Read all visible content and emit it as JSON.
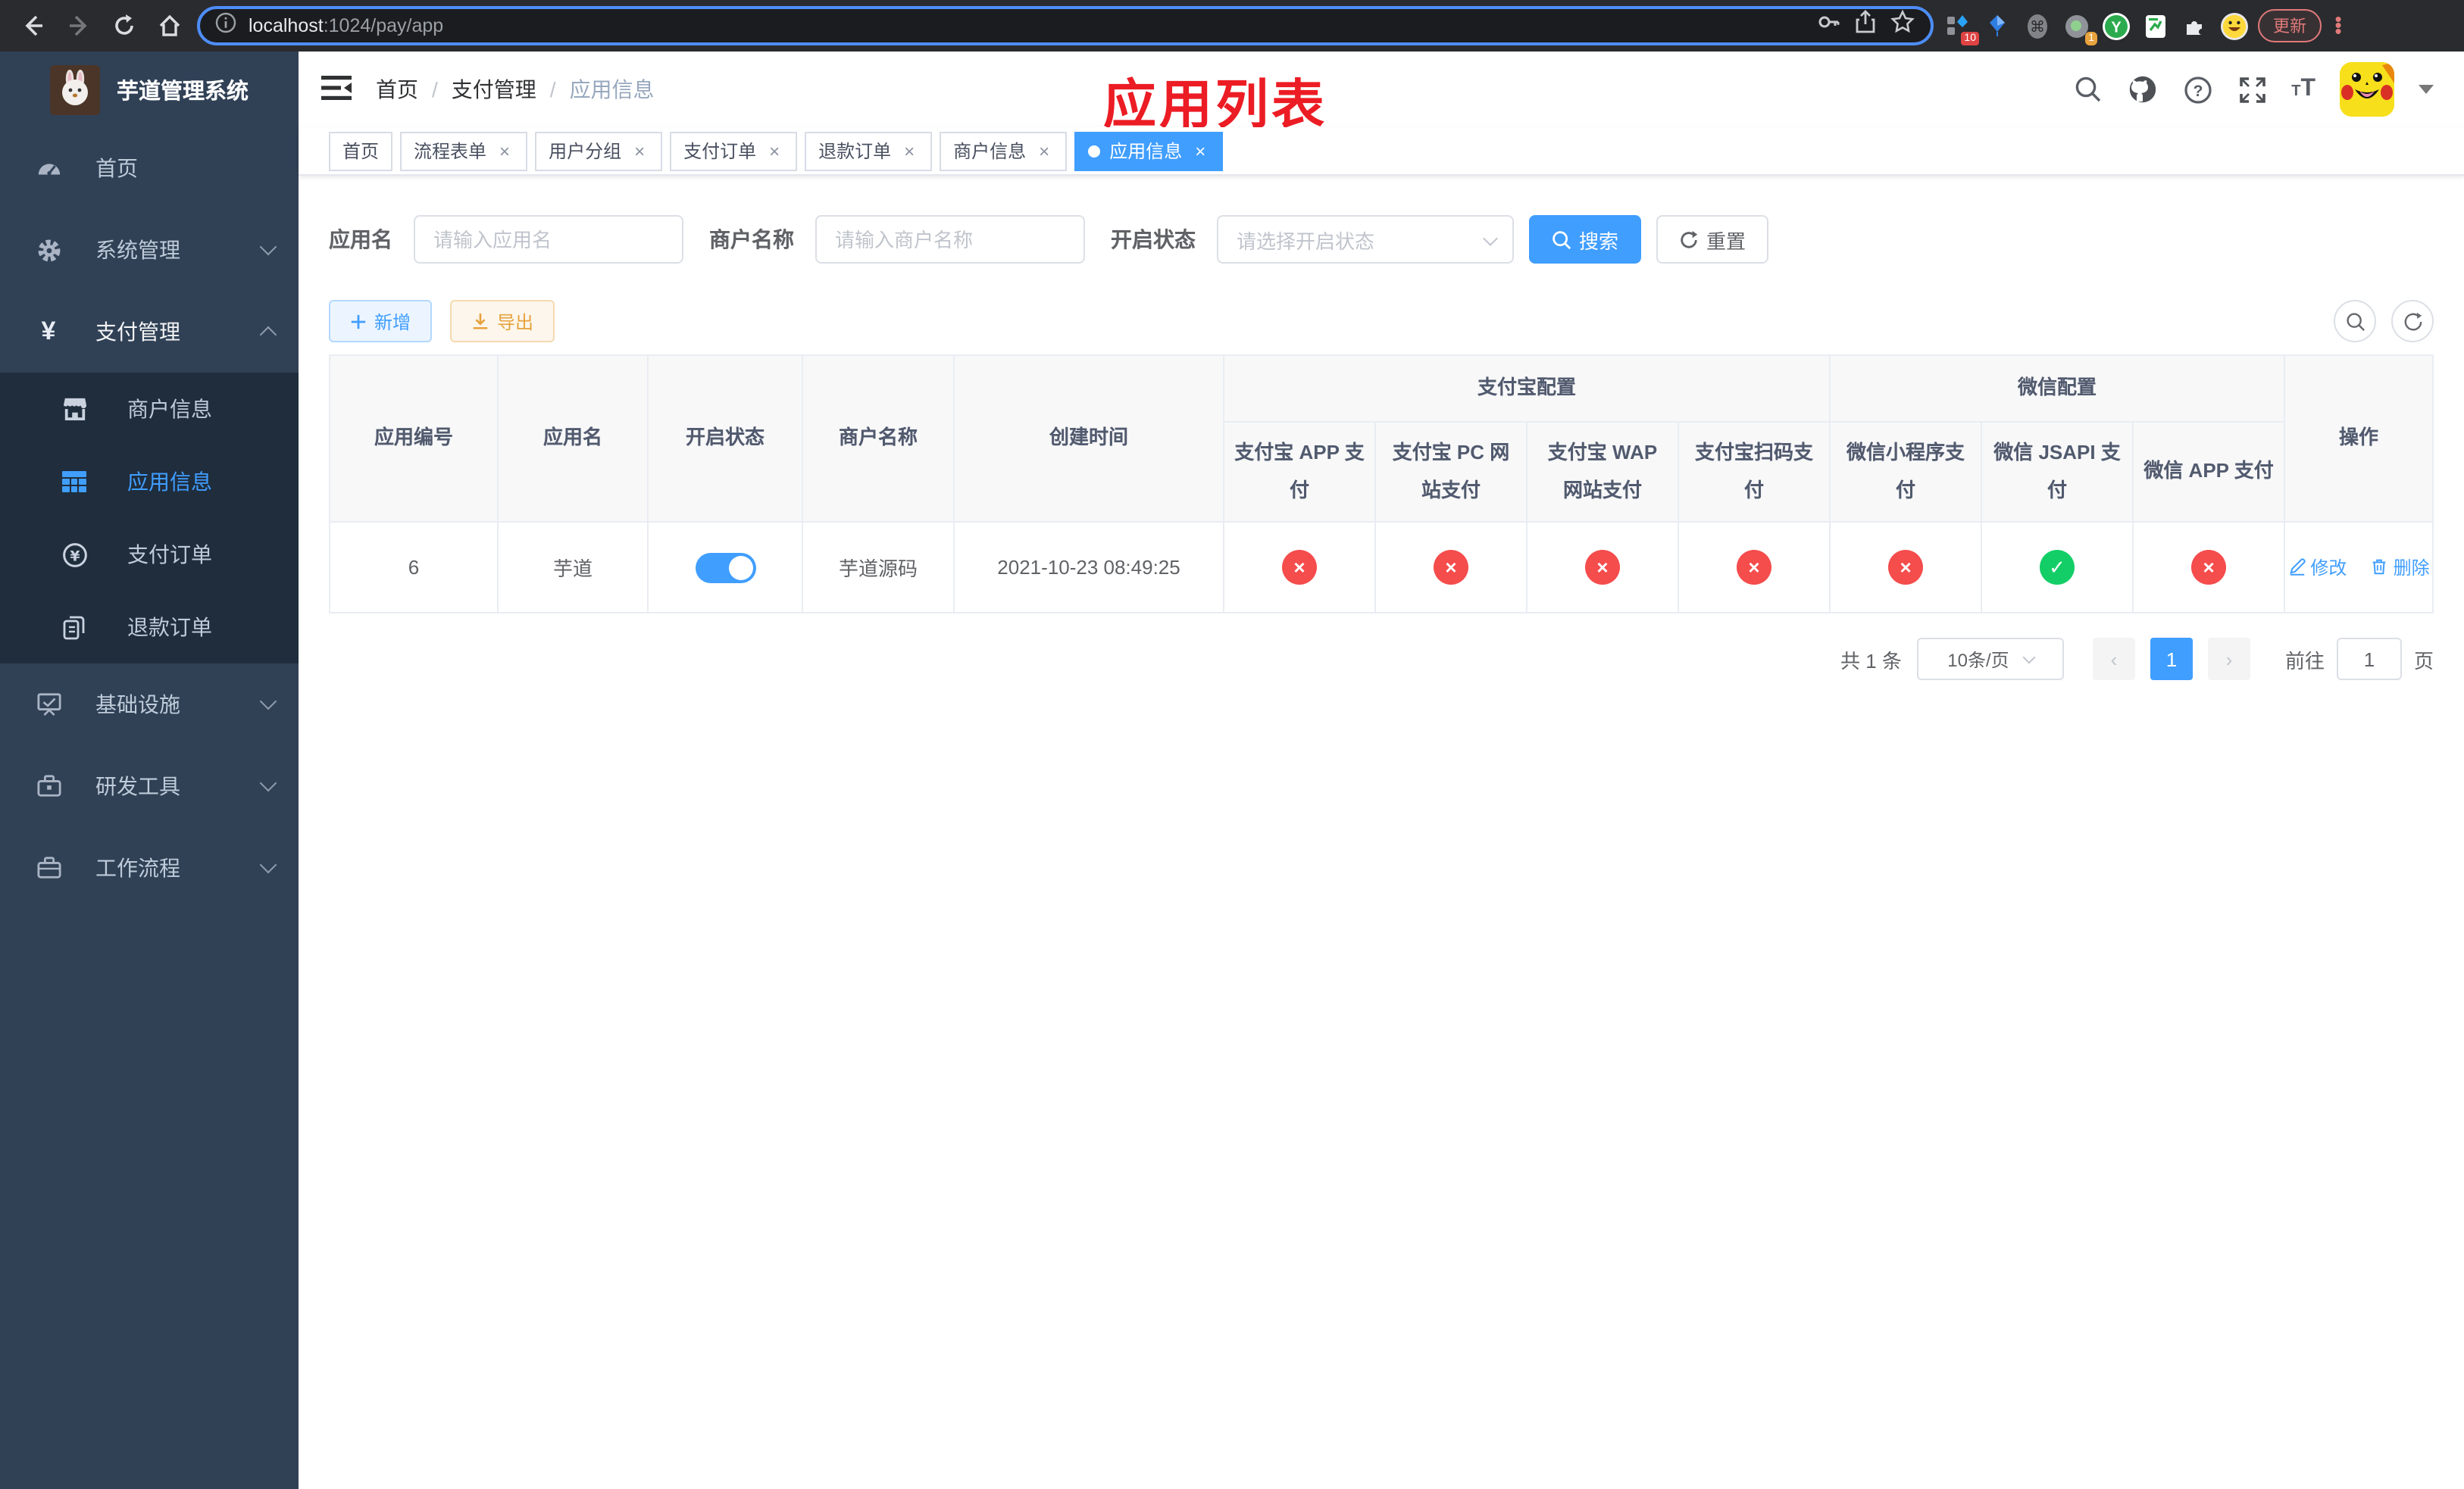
{
  "browser": {
    "url_host": "localhost",
    "url_path": ":1024/pay/app",
    "update_button": "更新",
    "ext_badge_blocks": "10",
    "ext_badge_circle": "1",
    "ext_y_label": "Y"
  },
  "sidebar": {
    "title": "芋道管理系统",
    "items": [
      {
        "label": "首页"
      },
      {
        "label": "系统管理"
      },
      {
        "label": "支付管理"
      },
      {
        "label": "商户信息"
      },
      {
        "label": "应用信息"
      },
      {
        "label": "支付订单"
      },
      {
        "label": "退款订单"
      },
      {
        "label": "基础设施"
      },
      {
        "label": "研发工具"
      },
      {
        "label": "工作流程"
      }
    ]
  },
  "navbar": {
    "breadcrumb": [
      "首页",
      "支付管理",
      "应用信息"
    ],
    "separator": "/",
    "annotation": "应用列表"
  },
  "tabs": [
    {
      "label": "首页"
    },
    {
      "label": "流程表单"
    },
    {
      "label": "用户分组"
    },
    {
      "label": "支付订单"
    },
    {
      "label": "退款订单"
    },
    {
      "label": "商户信息"
    },
    {
      "label": "应用信息"
    }
  ],
  "filters": {
    "app_name_label": "应用名",
    "app_name_placeholder": "请输入应用名",
    "merchant_label": "商户名称",
    "merchant_placeholder": "请输入商户名称",
    "status_label": "开启状态",
    "status_placeholder": "请选择开启状态",
    "search_button": "搜索",
    "reset_button": "重置"
  },
  "toolbar": {
    "add_button": "新增",
    "export_button": "导出"
  },
  "table": {
    "columns": [
      "应用编号",
      "应用名",
      "开启状态",
      "商户名称",
      "创建时间"
    ],
    "group_alipay": "支付宝配置",
    "group_wechat": "微信配置",
    "sub_columns": [
      "支付宝 APP 支付",
      "支付宝 PC 网站支付",
      "支付宝 WAP 网站支付",
      "支付宝扫码支付",
      "微信小程序支付",
      "微信 JSAPI 支付",
      "微信 APP 支付"
    ],
    "actions_column": "操作",
    "row": {
      "id": "6",
      "name": "芋道",
      "enabled": true,
      "merchant": "芋道源码",
      "created_at": "2021-10-23 08:49:25",
      "statuses": [
        "no",
        "no",
        "no",
        "no",
        "no",
        "yes",
        "no"
      ],
      "edit_label": "修改",
      "delete_label": "删除"
    }
  },
  "pagination": {
    "total": "共 1 条",
    "page_size": "10条/页",
    "current_page": "1",
    "goto_label": "前往",
    "goto_value": "1",
    "page_unit": "页"
  },
  "colors": {
    "primary": "#409eff",
    "sidebar_bg": "#304156",
    "submenu_bg": "#1f2d3d",
    "danger": "#f54c4c",
    "success": "#13ce66",
    "warning": "#e6a23c",
    "annotation_red": "#ec1c24"
  }
}
